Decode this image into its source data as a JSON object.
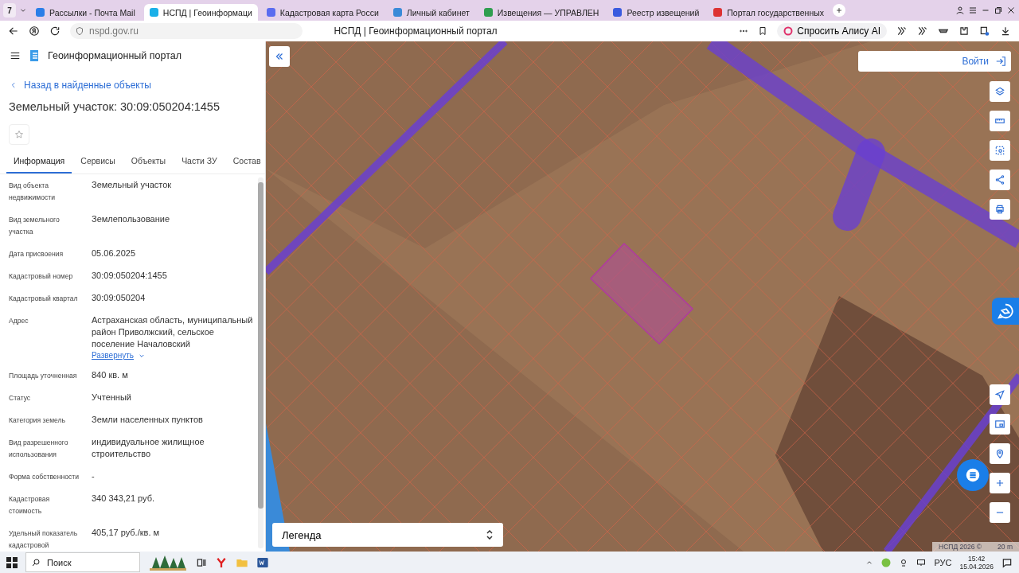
{
  "browser": {
    "tab_count": "7",
    "tabs": [
      {
        "title": "Рассылки - Почта Mail",
        "selected": false
      },
      {
        "title": "НСПД | Геоинформаци",
        "selected": true
      },
      {
        "title": "Кадастровая карта Росси",
        "selected": false
      },
      {
        "title": "Личный кабинет",
        "selected": false
      },
      {
        "title": "Извещения — УПРАВЛЕН",
        "selected": false
      },
      {
        "title": "Реестр извещений",
        "selected": false
      },
      {
        "title": "Портал государственных",
        "selected": false
      }
    ],
    "address": "nspd.gov.ru",
    "page_title": "НСПД | Геоинформационный портал",
    "alice_button": "Спросить Алису AI"
  },
  "sidebar": {
    "app_title": "Геоинформационный портал",
    "back_link": "Назад в найденные объекты",
    "heading": "Земельный участок: 30:09:050204:1455",
    "tabs": [
      {
        "label": "Информация",
        "selected": true
      },
      {
        "label": "Сервисы",
        "selected": false
      },
      {
        "label": "Объекты",
        "selected": false
      },
      {
        "label": "Части ЗУ",
        "selected": false
      },
      {
        "label": "Состав",
        "selected": false
      }
    ],
    "fields": [
      {
        "label": "Вид объекта недвижимости",
        "value": "Земельный участок"
      },
      {
        "label": "Вид земельного участка",
        "value": "Землепользование"
      },
      {
        "label": "Дата присвоения",
        "value": "05.06.2025"
      },
      {
        "label": "Кадастровый номер",
        "value": "30:09:050204:1455"
      },
      {
        "label": "Кадастровый квартал",
        "value": "30:09:050204"
      },
      {
        "label": "Адрес",
        "value": "Астраханская область, муниципальный район Приволжский, сельское поселение Началовский",
        "link": "Развернуть"
      },
      {
        "label": "Площадь уточненная",
        "value": "840 кв. м"
      },
      {
        "label": "Статус",
        "value": "Учтенный"
      },
      {
        "label": "Категория земель",
        "value": "Земли населенных пунктов"
      },
      {
        "label": "Вид разрешенного использования",
        "value": "индивидуальное жилищное строительство"
      },
      {
        "label": "Форма собственности",
        "value": "-"
      },
      {
        "label": "Кадастровая стоимость",
        "value": "340 343,21 руб."
      },
      {
        "label": "Удельный показатель кадастровой",
        "value": "405,17 руб./кв. м"
      }
    ]
  },
  "map": {
    "login_button": "Войти",
    "legend": "Легенда",
    "attribution": "НСПД 2026 ©",
    "scale": "20 m"
  },
  "taskbar": {
    "search": "Поиск",
    "language": "РУС",
    "time": "15:42",
    "date": "15.04.2026"
  }
}
